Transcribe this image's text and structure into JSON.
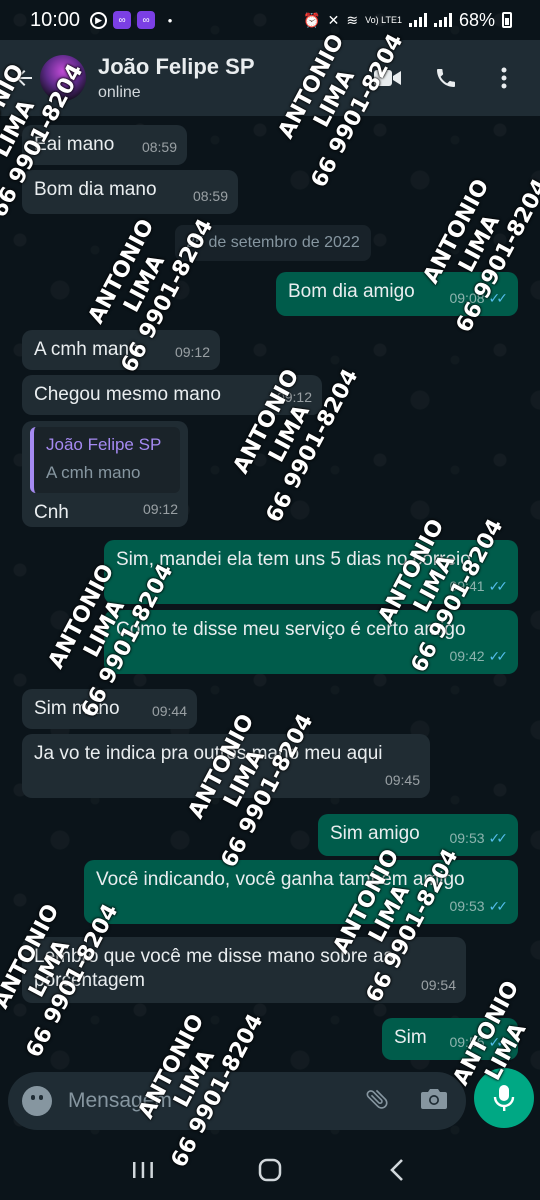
{
  "status_bar": {
    "time": "10:00",
    "battery": "68%",
    "network": "Vo) LTE1"
  },
  "header": {
    "name": "João Felipe SP",
    "status": "online"
  },
  "date_chip": "25 de setembro de 2022",
  "messages": [
    {
      "text": "Eai mano",
      "time": "08:59"
    },
    {
      "text": "Bom dia mano",
      "time": "08:59"
    },
    {
      "text": "Bom dia amigo",
      "time": "09:08"
    },
    {
      "text": "A cmh mano",
      "time": "09:12"
    },
    {
      "text": "Chegou mesmo mano",
      "time": "09:12"
    },
    {
      "quote_author": "João Felipe SP",
      "quote_text": "A cmh mano",
      "text": "Cnh",
      "time": "09:12"
    },
    {
      "text": "Sim, mandei ela tem uns 5 dias no correio",
      "time": "09:41"
    },
    {
      "text": "Como te disse meu serviço é certo amigo",
      "time": "09:42"
    },
    {
      "text": "Sim mano",
      "time": "09:44"
    },
    {
      "text": "Ja vo te indica pra outros mano meu aqui",
      "time": "09:45"
    },
    {
      "text": "Sim amigo",
      "time": "09:53"
    },
    {
      "text": "Você indicando, você ganha também amigo",
      "time": "09:53"
    },
    {
      "text": "Lembro que você me disse mano sobre as porcentagem",
      "time": "09:54"
    },
    {
      "text": "Sim",
      "time": "09:56"
    }
  ],
  "input": {
    "placeholder": "Mensagem"
  },
  "watermark": {
    "name": "ANTONIO LIMA",
    "phone": "66 9901-8204"
  },
  "colors": {
    "incoming": "#202c33",
    "outgoing": "#005c4b",
    "header": "#1f2c34",
    "accent": "#00a884",
    "read_tick": "#53bdeb"
  }
}
